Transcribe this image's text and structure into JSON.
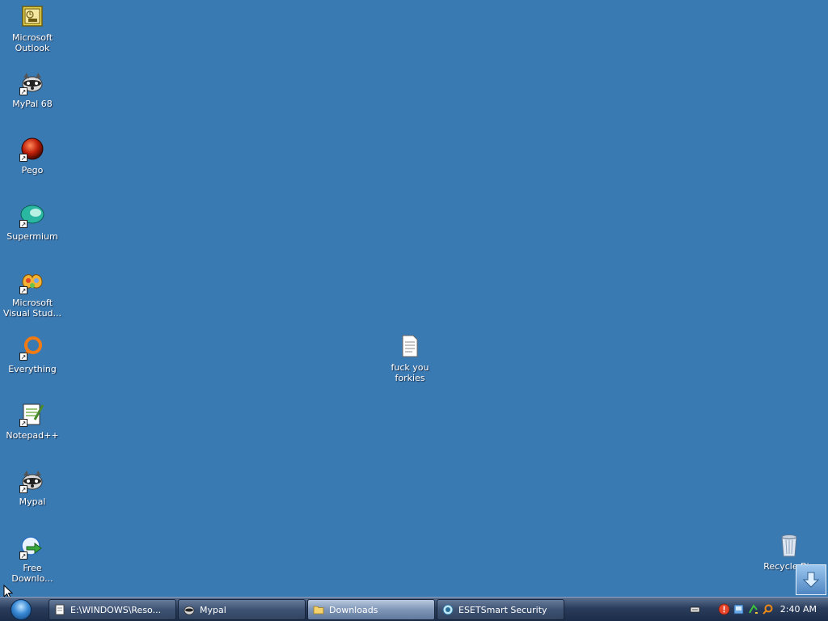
{
  "desktop": {
    "icons": [
      {
        "label": "Microsoft Outlook",
        "icon": "outlook-icon"
      },
      {
        "label": "MyPal 68",
        "icon": "raccoon-icon"
      },
      {
        "label": "Pego",
        "icon": "red-sphere-icon"
      },
      {
        "label": "Supermium",
        "icon": "supermium-icon"
      },
      {
        "label": "Microsoft Visual Stud...",
        "icon": "visual-studio-icon"
      },
      {
        "label": "Everything",
        "icon": "magnifier-icon"
      },
      {
        "label": "Notepad++",
        "icon": "notepad-plus-plus-icon"
      },
      {
        "label": "Mypal",
        "icon": "raccoon-icon"
      },
      {
        "label": "Free Downlo...",
        "icon": "free-download-manager-icon"
      },
      {
        "label": "fuck you forkies",
        "icon": "text-document-icon"
      },
      {
        "label": "Recycle Bin",
        "icon": "recycle-bin-icon"
      }
    ]
  },
  "taskbar": {
    "start_icon": "windows-start-orb-icon",
    "buttons": [
      {
        "label": "E:\\WINDOWS\\Reso...",
        "icon": "notepad-icon",
        "active": false
      },
      {
        "label": "Mypal",
        "icon": "raccoon-icon",
        "active": false
      },
      {
        "label": "Downloads",
        "icon": "folder-icon",
        "active": true
      },
      {
        "label": "ESETSmart Security",
        "icon": "eset-icon",
        "active": false
      }
    ],
    "tray_icons": [
      "keyboard-icon",
      "security-alert-icon",
      "network-icon",
      "green-arrow-icon",
      "search-icon"
    ],
    "clock": "2:40 AM"
  },
  "colors": {
    "desktop_background": "#3a7ab3",
    "taskbar": "#2a3d5c",
    "label_text": "#ffffff"
  }
}
